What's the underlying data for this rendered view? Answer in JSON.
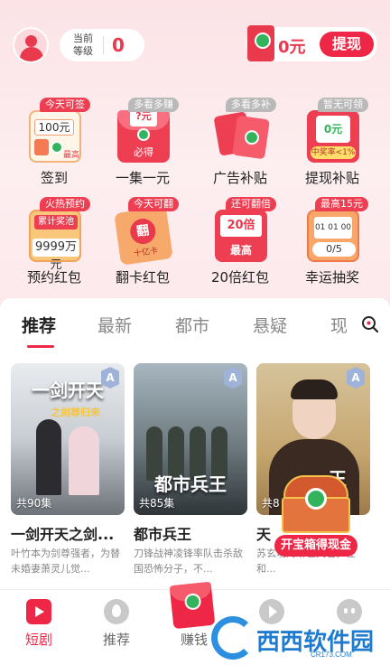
{
  "header": {
    "level_label": "当前等级",
    "level_value": "0",
    "wallet_amount": "0元",
    "withdraw_label": "提现"
  },
  "grid": [
    {
      "tag": "今天可签",
      "label": "签到",
      "inner": "100元",
      "mini": "最高"
    },
    {
      "tag": "多看多赚",
      "label": "一集一元",
      "inner": "?元",
      "mini": "必得"
    },
    {
      "tag": "多看多补",
      "label": "广告补贴"
    },
    {
      "tag": "暂无可领",
      "label": "提现补贴",
      "inner": "0元",
      "mini": "中奖率<1%"
    },
    {
      "tag": "火热预约",
      "label": "预约红包",
      "inner": "累计奖池",
      "mini": "9999万元"
    },
    {
      "tag": "今天可翻",
      "label": "翻卡红包",
      "inner": "翻",
      "mini": "十亿卡"
    },
    {
      "tag": "还可翻倍",
      "label": "20倍红包",
      "inner": "20倍",
      "mini": "最高"
    },
    {
      "tag": "最高15元",
      "label": "幸运抽奖",
      "inner": "01 01 00",
      "mini": "0/5"
    }
  ],
  "tabs": [
    "推荐",
    "最新",
    "都市",
    "悬疑",
    "现"
  ],
  "cards": [
    {
      "badge": "A",
      "episodes": "共90集",
      "cover_title": "一剑开天",
      "cover_sub": "之剑尊归来",
      "title": "一剑开天之剑...",
      "desc": "叶竹本为剑尊强者，为替未婚妻萧灵儿觉..."
    },
    {
      "badge": "A",
      "episodes": "共85集",
      "cover_title": "都市兵王",
      "title": "都市兵王",
      "desc": "刀锋战神凌锋率队击杀敌国恐怖分子，不..."
    },
    {
      "badge": "A",
      "episodes": "共8",
      "cover_title": "王",
      "title": "天",
      "desc": "苏玄境的蟒雀天君，在和..."
    }
  ],
  "treasure_label": "开宝箱得现金",
  "bottom_nav": [
    {
      "label": "短剧",
      "icon": "tv-icon",
      "active": true
    },
    {
      "label": "推荐",
      "icon": "fire-icon",
      "active": false
    },
    {
      "label": "赚钱",
      "icon": "red-envelope-icon",
      "active": false
    },
    {
      "label": "",
      "icon": "play-icon",
      "active": false
    },
    {
      "label": "",
      "icon": "face-icon",
      "active": false
    }
  ],
  "watermark": {
    "brand": "西西软件园",
    "sub": "CR173.COM"
  },
  "colors": {
    "accent": "#ee2746",
    "green": "#32b35c",
    "header_bg": "#fbe3e6"
  }
}
